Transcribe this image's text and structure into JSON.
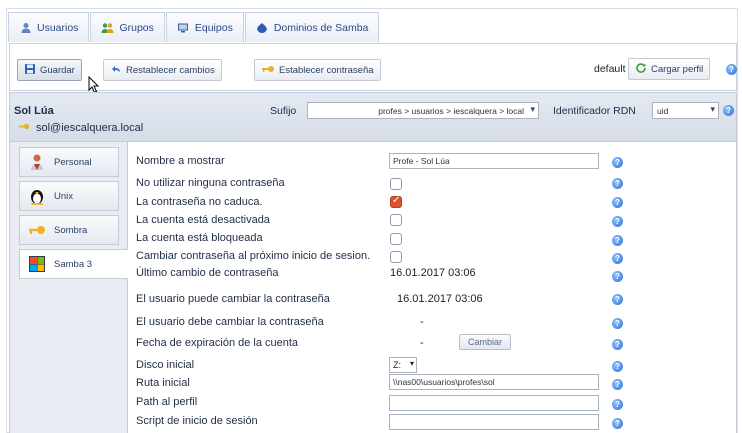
{
  "tabs": [
    {
      "label": "Usuarios",
      "icon": "users-icon"
    },
    {
      "label": "Grupos",
      "icon": "groups-icon"
    },
    {
      "label": "Equipos",
      "icon": "computers-icon"
    },
    {
      "label": "Dominios de Samba",
      "icon": "samba-domain-icon"
    }
  ],
  "toolbar": {
    "save_label": "Guardar",
    "reset_label": "Restablecer cambios",
    "set_password_label": "Establecer contraseña",
    "profile_name": "default",
    "load_profile_label": "Cargar perfil"
  },
  "user": {
    "name": "Sol Lúa",
    "email": "sol@iescalquera.local",
    "suffix_label": "Sufijo",
    "suffix_value": "profes > usuarios > iescalquera > local",
    "rdn_label": "Identificador RDN",
    "rdn_value": "uid"
  },
  "side_tabs": [
    {
      "label": "Personal",
      "icon": "personal-icon"
    },
    {
      "label": "Unix",
      "icon": "tux-icon"
    },
    {
      "label": "Sombra",
      "icon": "key-icon"
    },
    {
      "label": "Samba 3",
      "icon": "samba3-icon"
    }
  ],
  "form": {
    "display_name_label": "Nombre a mostrar",
    "display_name_value": "Profe - Sol Lúa",
    "no_password_label": "No utilizar ninguna contraseña",
    "no_password_checked": false,
    "no_expire_label": "La contraseña no caduca.",
    "no_expire_checked": true,
    "disabled_label": "La cuenta está desactivada",
    "disabled_checked": false,
    "locked_label": "La cuenta está bloqueada",
    "locked_checked": false,
    "change_next_label": "Cambiar contraseña al próximo inicio de sesion.",
    "change_next_checked": false,
    "last_change_label": "Último cambio de contraseña",
    "last_change_value": "16.01.2017 03:06",
    "can_change_label": "El usuario puede cambiar la contraseña",
    "can_change_value": "16.01.2017 03:06",
    "must_change_label": "El usuario debe cambiar la contraseña",
    "must_change_value": "-",
    "expiration_label": "Fecha de expiración de la cuenta",
    "expiration_value": "-",
    "change_button_label": "Cambiar",
    "home_drive_label": "Disco inicial",
    "home_drive_value": "Z:",
    "home_path_label": "Ruta inicial",
    "home_path_value": "\\\\nas00\\usuarios\\profes\\sol",
    "profile_path_label": "Path al perfil",
    "profile_path_value": "",
    "logon_script_label": "Script de inicio de sesión",
    "logon_script_value": ""
  }
}
